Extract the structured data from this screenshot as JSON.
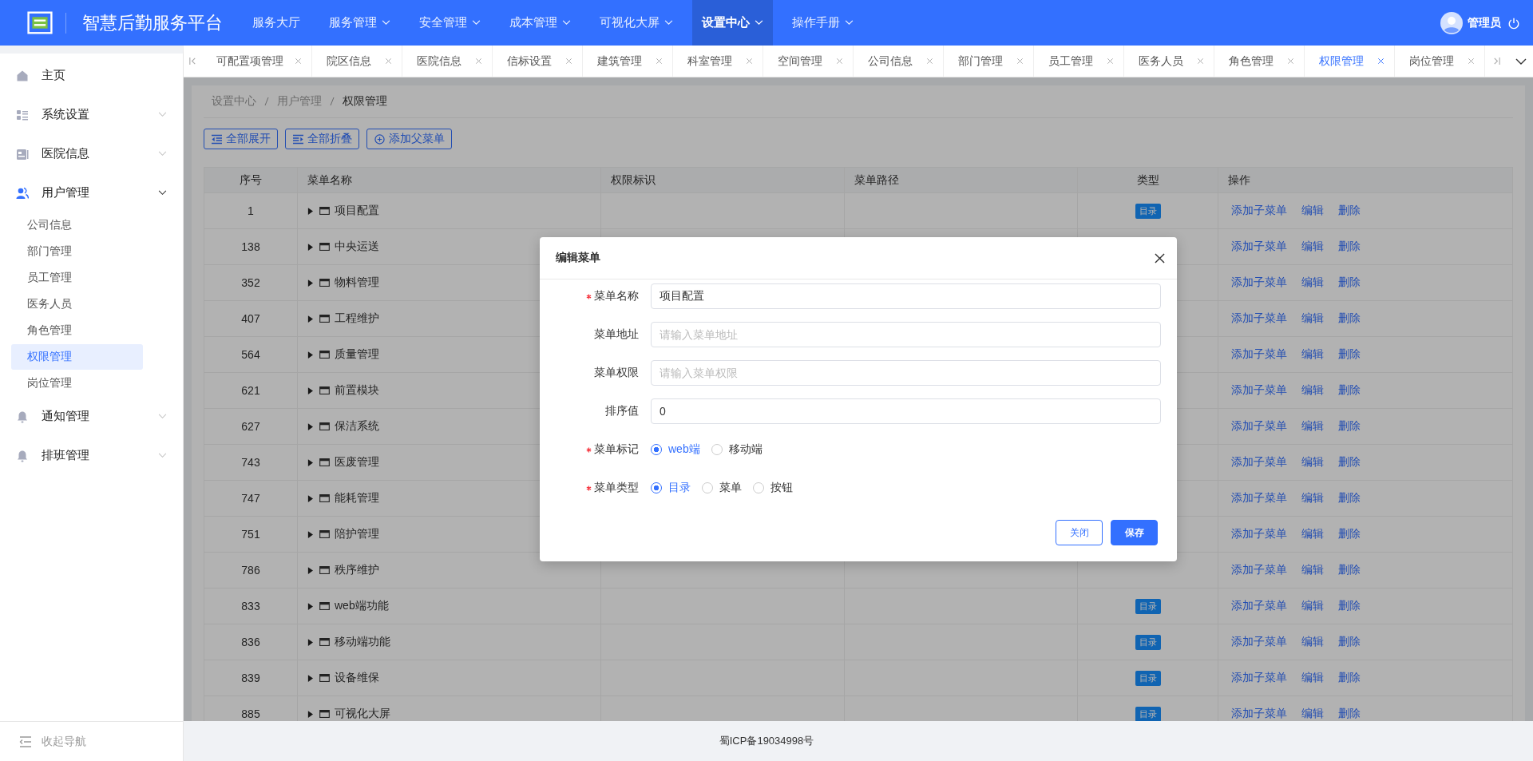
{
  "header": {
    "title": "智慧后勤服务平台",
    "nav": [
      {
        "label": "服务大厅",
        "selected": false,
        "dropdown": false
      },
      {
        "label": "服务管理",
        "selected": false,
        "dropdown": true
      },
      {
        "label": "安全管理",
        "selected": false,
        "dropdown": true
      },
      {
        "label": "成本管理",
        "selected": false,
        "dropdown": true
      },
      {
        "label": "可视化大屏",
        "selected": false,
        "dropdown": true
      },
      {
        "label": "设置中心",
        "selected": true,
        "dropdown": true
      },
      {
        "label": "操作手册",
        "selected": false,
        "dropdown": true
      }
    ],
    "user": {
      "name": "管理员"
    }
  },
  "sidebar": {
    "items": [
      {
        "label": "主页"
      },
      {
        "label": "系统设置",
        "expanded": false
      },
      {
        "label": "医院信息",
        "expanded": false
      },
      {
        "label": "用户管理",
        "expanded": true,
        "children": [
          {
            "label": "公司信息",
            "selected": false
          },
          {
            "label": "部门管理",
            "selected": false
          },
          {
            "label": "员工管理",
            "selected": false
          },
          {
            "label": "医务人员",
            "selected": false
          },
          {
            "label": "角色管理",
            "selected": false
          },
          {
            "label": "权限管理",
            "selected": true
          },
          {
            "label": "岗位管理",
            "selected": false
          }
        ]
      },
      {
        "label": "通知管理",
        "expanded": false
      },
      {
        "label": "排班管理",
        "expanded": false
      }
    ],
    "collapse_label": "收起导航"
  },
  "tabs": [
    {
      "label": "可配置项管理",
      "selected": false
    },
    {
      "label": "院区信息",
      "selected": false
    },
    {
      "label": "医院信息",
      "selected": false
    },
    {
      "label": "信标设置",
      "selected": false
    },
    {
      "label": "建筑管理",
      "selected": false
    },
    {
      "label": "科室管理",
      "selected": false
    },
    {
      "label": "空间管理",
      "selected": false
    },
    {
      "label": "公司信息",
      "selected": false
    },
    {
      "label": "部门管理",
      "selected": false
    },
    {
      "label": "员工管理",
      "selected": false
    },
    {
      "label": "医务人员",
      "selected": false
    },
    {
      "label": "角色管理",
      "selected": false
    },
    {
      "label": "权限管理",
      "selected": true
    },
    {
      "label": "岗位管理",
      "selected": false
    }
  ],
  "breadcrumb": [
    "设置中心",
    "用户管理",
    "权限管理"
  ],
  "toolbar": [
    {
      "label": "全部展开"
    },
    {
      "label": "全部折叠"
    },
    {
      "label": "添加父菜单"
    }
  ],
  "table": {
    "columns": [
      "序号",
      "菜单名称",
      "权限标识",
      "菜单路径",
      "类型",
      "操作"
    ],
    "rows": [
      {
        "index": "1",
        "name": "项目配置",
        "type": "目录",
        "actions": [
          "添加子菜单",
          "编辑",
          "删除"
        ]
      },
      {
        "index": "138",
        "name": "中央运送",
        "actions": [
          "添加子菜单",
          "编辑",
          "删除"
        ]
      },
      {
        "index": "352",
        "name": "物料管理",
        "actions": [
          "添加子菜单",
          "编辑",
          "删除"
        ]
      },
      {
        "index": "407",
        "name": "工程维护",
        "actions": [
          "添加子菜单",
          "编辑",
          "删除"
        ]
      },
      {
        "index": "564",
        "name": "质量管理",
        "actions": [
          "添加子菜单",
          "编辑",
          "删除"
        ]
      },
      {
        "index": "621",
        "name": "前置模块",
        "actions": [
          "添加子菜单",
          "编辑",
          "删除"
        ]
      },
      {
        "index": "627",
        "name": "保洁系统",
        "actions": [
          "添加子菜单",
          "编辑",
          "删除"
        ]
      },
      {
        "index": "743",
        "name": "医废管理",
        "actions": [
          "添加子菜单",
          "编辑",
          "删除"
        ]
      },
      {
        "index": "747",
        "name": "能耗管理",
        "actions": [
          "添加子菜单",
          "编辑",
          "删除"
        ]
      },
      {
        "index": "751",
        "name": "陪护管理",
        "actions": [
          "添加子菜单",
          "编辑",
          "删除"
        ]
      },
      {
        "index": "786",
        "name": "秩序维护",
        "actions": [
          "添加子菜单",
          "编辑",
          "删除"
        ]
      },
      {
        "index": "833",
        "name": "web端功能",
        "type": "目录",
        "actions": [
          "添加子菜单",
          "编辑",
          "删除"
        ]
      },
      {
        "index": "836",
        "name": "移动端功能",
        "type": "目录",
        "actions": [
          "添加子菜单",
          "编辑",
          "删除"
        ]
      },
      {
        "index": "839",
        "name": "设备维保",
        "type": "目录",
        "actions": [
          "添加子菜单",
          "编辑",
          "删除"
        ]
      },
      {
        "index": "885",
        "name": "可视化大屏",
        "type": "目录",
        "actions": [
          "添加子菜单",
          "编辑",
          "删除"
        ]
      }
    ]
  },
  "modal": {
    "title": "编辑菜单",
    "fields": [
      {
        "kind": "text",
        "label": "菜单名称",
        "required": true,
        "value": "项目配置"
      },
      {
        "kind": "text",
        "label": "菜单地址",
        "required": false,
        "placeholder": "请输入菜单地址"
      },
      {
        "kind": "text",
        "label": "菜单权限",
        "required": false,
        "placeholder": "请输入菜单权限"
      },
      {
        "kind": "text",
        "label": "排序值",
        "required": false,
        "value": "0"
      },
      {
        "kind": "radio",
        "label": "菜单标记",
        "required": true,
        "options": [
          {
            "label": "web端",
            "selected": true
          },
          {
            "label": "移动端",
            "selected": false
          }
        ]
      },
      {
        "kind": "radio",
        "label": "菜单类型",
        "required": true,
        "options": [
          {
            "label": "目录",
            "selected": true
          },
          {
            "label": "菜单",
            "selected": false
          },
          {
            "label": "按钮",
            "selected": false
          }
        ]
      }
    ],
    "buttons": [
      {
        "label": "关闭",
        "kind": "default"
      },
      {
        "label": "保存",
        "kind": "primary"
      }
    ]
  },
  "footer": "蜀ICP备19034998号"
}
